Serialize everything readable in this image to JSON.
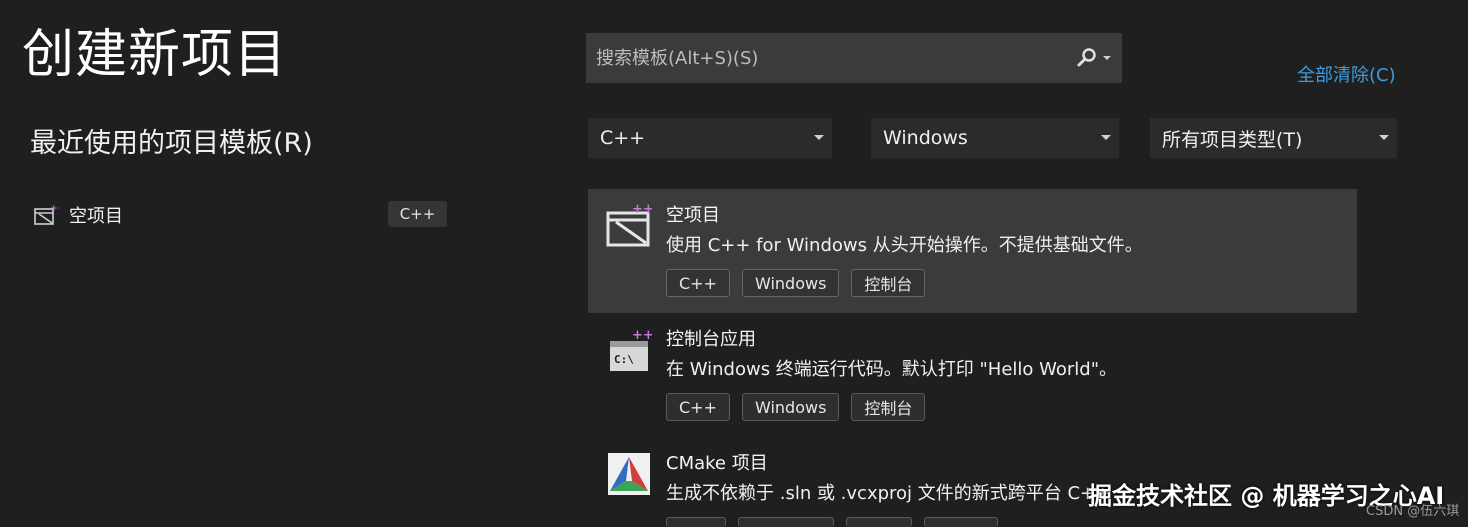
{
  "page": {
    "title": "创建新项目",
    "clear_all": "全部清除(C)"
  },
  "search": {
    "placeholder": "搜索模板(Alt+S)(S)"
  },
  "recent": {
    "heading": "最近使用的项目模板(R)",
    "items": [
      {
        "label": "空项目",
        "tag": "C++"
      }
    ]
  },
  "filters": {
    "language": "C++",
    "platform": "Windows",
    "project_type": "所有项目类型(T)"
  },
  "templates": [
    {
      "title": "空项目",
      "description": "使用 C++ for Windows 从头开始操作。不提供基础文件。",
      "tags": [
        "C++",
        "Windows",
        "控制台"
      ]
    },
    {
      "title": "控制台应用",
      "description": "在 Windows 终端运行代码。默认打印 \"Hello World\"。",
      "tags": [
        "C++",
        "Windows",
        "控制台"
      ]
    },
    {
      "title": "CMake 项目",
      "description": "生成不依赖于 .sln 或 .vcxproj 文件的新式跨平台 C++",
      "tags": []
    }
  ],
  "watermark": {
    "text": "掘金技术社区 @ 机器学习之心AI",
    "csdn": "CSDN @伍六琪"
  },
  "colors": {
    "background": "#1f1f1f",
    "selected_row": "#3b3b3b",
    "link": "#3b9ddd",
    "accent_plus": "#c678dd"
  }
}
